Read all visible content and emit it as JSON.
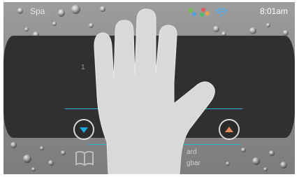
{
  "status_bar": {
    "carrier": "Spa",
    "time": "8:01am",
    "icons": [
      "app-colored-dots-icon",
      "wifi-icon"
    ]
  },
  "band": {
    "number": "1"
  },
  "buttons": {
    "down_icon": "arrow-down-icon",
    "up_icon": "arrow-up-icon"
  },
  "bottom": {
    "icon": "book-icon",
    "label_line1": "ard",
    "label_line2": "gbar"
  },
  "overlay": {
    "icon": "hand-icon"
  },
  "colors": {
    "accent": "#29b6d0",
    "band": "#303030",
    "up_arrow": "#e08a5a",
    "down_arrow": "#1fa7e0"
  }
}
